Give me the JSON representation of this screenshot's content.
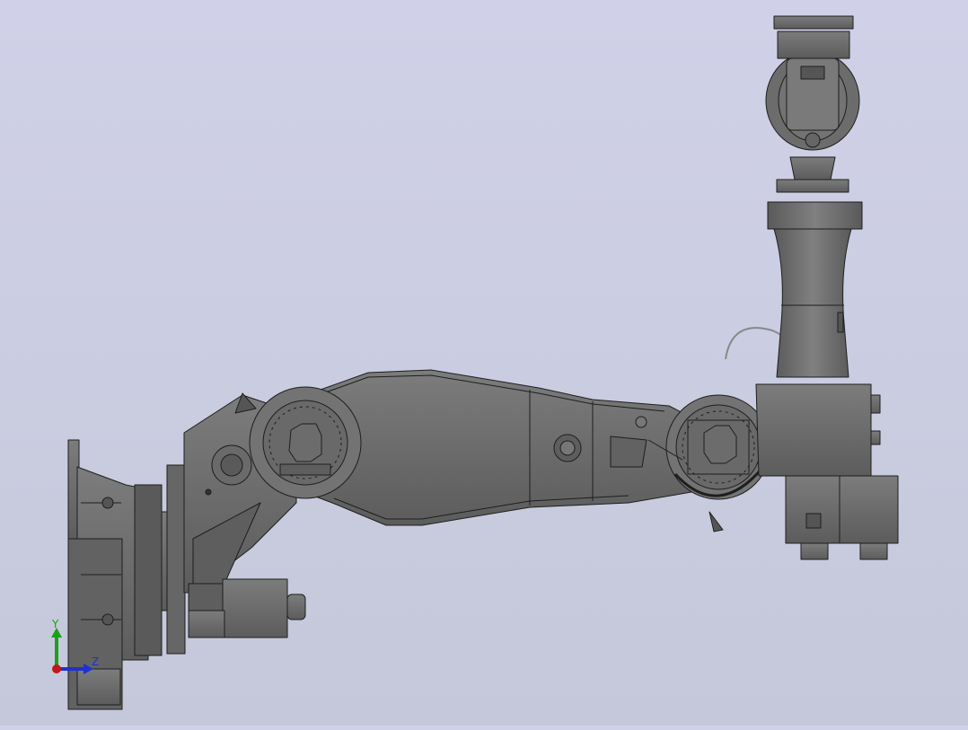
{
  "viewport": {
    "background_top": "#d0d1e8",
    "background_bottom": "#c5c8da",
    "model_color": "#6e6e6e",
    "model_edge_color": "#1e1e1e"
  },
  "triad": {
    "y_label": "Y",
    "z_label": "Z",
    "y_color": "#1aa01a",
    "z_color": "#2030d0",
    "x_color": "#c01818"
  }
}
